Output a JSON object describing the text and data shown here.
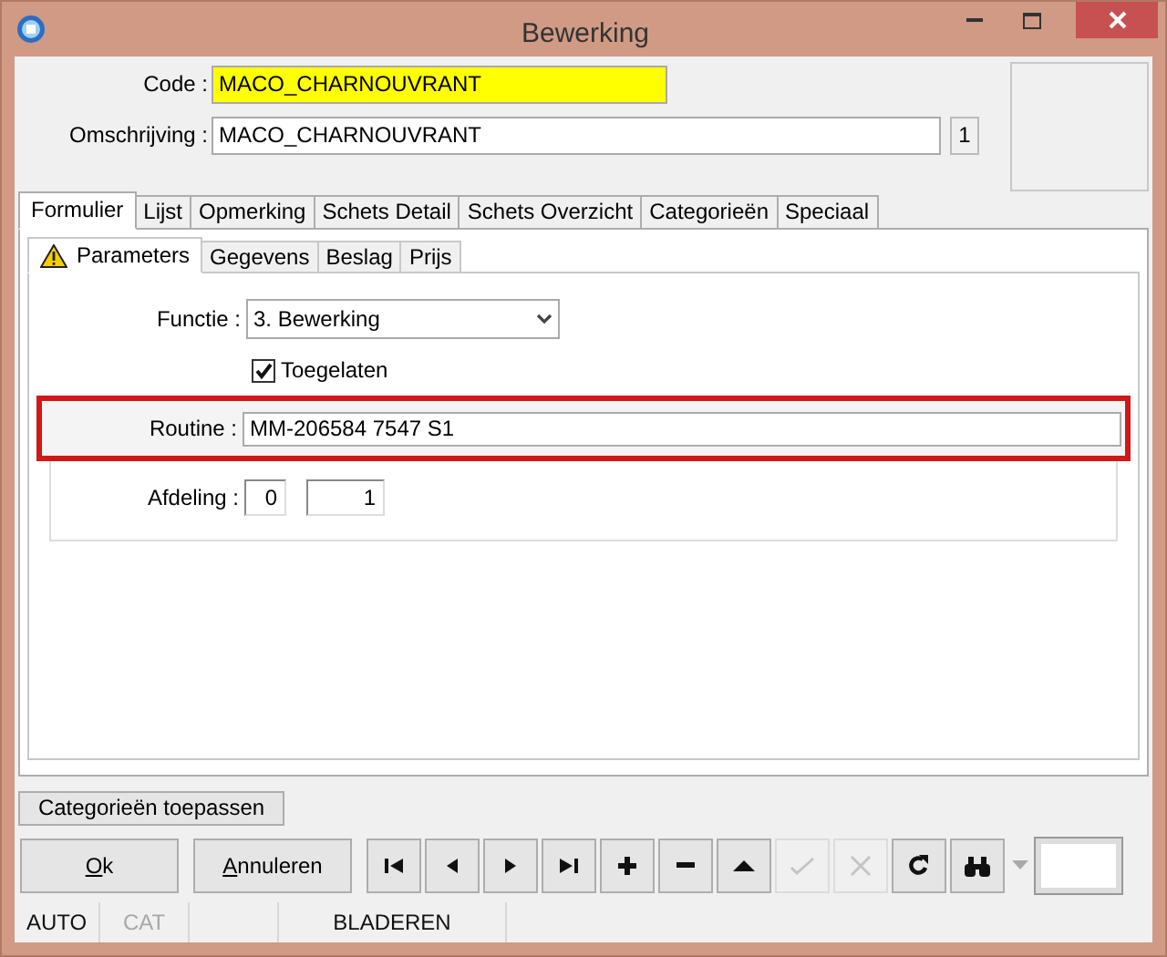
{
  "window": {
    "title": "Bewerking"
  },
  "header": {
    "code": {
      "label": "Code :",
      "value": "MACO_CHARNOUVRANT"
    },
    "description": {
      "label": "Omschrijving :",
      "value": "MACO_CHARNOUVRANT",
      "counter": "1"
    }
  },
  "tabs": [
    {
      "label": "Formulier",
      "selected": true
    },
    {
      "label": "Lijst",
      "selected": false
    },
    {
      "label": "Opmerking",
      "selected": false
    },
    {
      "label": "Schets Detail",
      "selected": false
    },
    {
      "label": "Schets Overzicht",
      "selected": false
    },
    {
      "label": "Categorieën",
      "selected": false
    },
    {
      "label": "Speciaal",
      "selected": false
    }
  ],
  "subtabs": [
    {
      "label": "Parameters",
      "selected": true,
      "warning": true
    },
    {
      "label": "Gegevens",
      "selected": false,
      "warning": false
    },
    {
      "label": "Beslag",
      "selected": false,
      "warning": false
    },
    {
      "label": "Prijs",
      "selected": false,
      "warning": false
    }
  ],
  "parameters": {
    "function": {
      "label": "Functie :",
      "value": "3.  Bewerking"
    },
    "allowed": {
      "label": "Toegelaten",
      "checked": true
    },
    "routine": {
      "label": "Routine :",
      "value": "MM-206584 7547 S1",
      "highlighted": true
    },
    "department": {
      "label": "Afdeling :",
      "values": [
        "0",
        "1"
      ]
    }
  },
  "apply_button": "Categorieën toepassen",
  "buttons": [
    {
      "label": "Ok",
      "underline_first": true
    },
    {
      "label": "Annuleren",
      "underline_first": true
    }
  ],
  "toolbar": [
    {
      "kind": "first",
      "disabled": false
    },
    {
      "kind": "prev",
      "disabled": false
    },
    {
      "kind": "next",
      "disabled": false
    },
    {
      "kind": "last",
      "disabled": false
    },
    {
      "kind": "add",
      "disabled": false
    },
    {
      "kind": "remove",
      "disabled": false
    },
    {
      "kind": "up",
      "disabled": false
    },
    {
      "kind": "confirm",
      "disabled": true
    },
    {
      "kind": "cancel",
      "disabled": true
    },
    {
      "kind": "refresh",
      "disabled": false
    },
    {
      "kind": "find",
      "disabled": false
    }
  ],
  "status_bar": [
    {
      "kind": "text",
      "text": "AUTO",
      "disabled": false
    },
    {
      "kind": "text",
      "text": "CAT",
      "disabled": true
    },
    {
      "kind": "blank"
    },
    {
      "kind": "text",
      "text": "BLADEREN",
      "disabled": false
    }
  ]
}
